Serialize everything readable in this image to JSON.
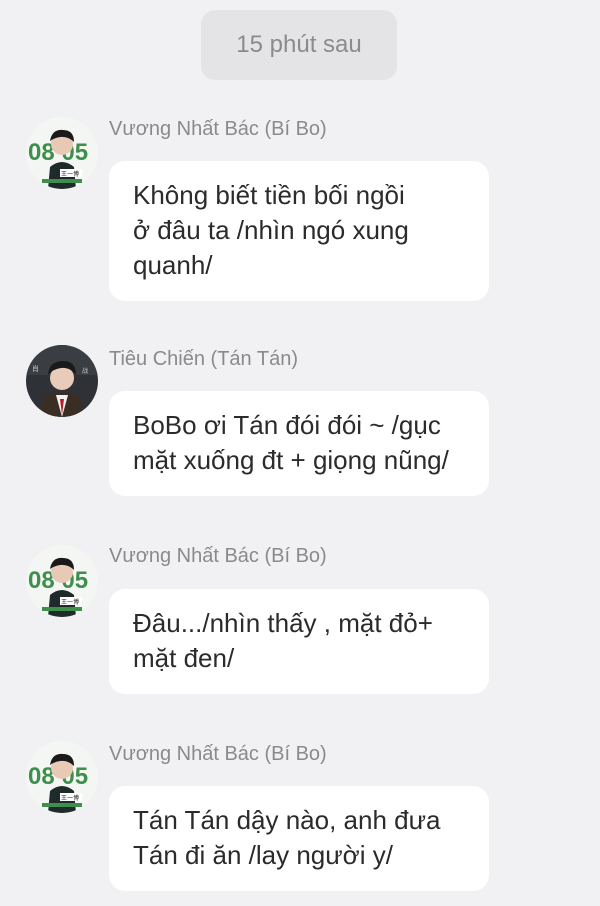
{
  "time_separator": "15 phút sau",
  "messages": [
    {
      "sender": "Vương Nhất Bác (Bí Bo)",
      "avatar": "avatar-wang-yibo",
      "lines": [
        "Không biết tiền bối ngồi",
        "ở đâu ta /nhìn ngó xung",
        "quanh/"
      ]
    },
    {
      "sender": "Tiêu Chiến (Tán Tán)",
      "avatar": "avatar-xiao-zhan",
      "lines": [
        "BoBo ơi Tán đói đói ~ /gục",
        "mặt xuống đt + giọng nũng/"
      ]
    },
    {
      "sender": "Vương Nhất Bác (Bí Bo)",
      "avatar": "avatar-wang-yibo",
      "lines": [
        "Đâu.../nhìn thấy , mặt đỏ+",
        "mặt đen/"
      ]
    },
    {
      "sender": "Vương Nhất Bác (Bí Bo)",
      "avatar": "avatar-wang-yibo",
      "lines": [
        "Tán Tán dậy nào, anh đưa",
        "Tán đi ăn /lay người y/"
      ]
    }
  ],
  "avatar_texts": {
    "birthday_date": "08 05",
    "birthday_caption": "王一博"
  },
  "colors": {
    "background": "#f1f1f3",
    "bubble": "#ffffff",
    "chip": "#e4e4e6",
    "sender_text": "#8a8a8d",
    "message_text": "#2b2b2b",
    "avatar_green": "#3f8f4c"
  }
}
